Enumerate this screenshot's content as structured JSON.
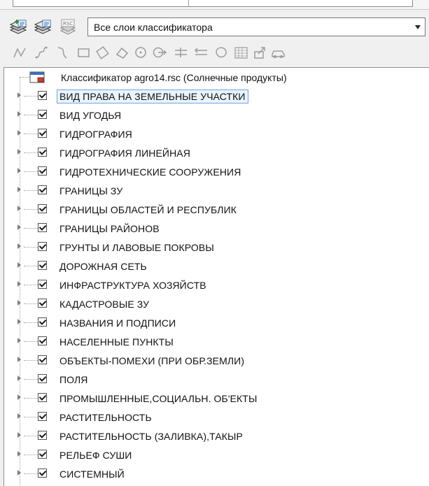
{
  "toolbar_top": {
    "classifier_select_value": "Все слои классификатора",
    "icons": [
      "layer-stack-add-icon",
      "layer-stack-edit-icon",
      "rsc-file-icon"
    ],
    "rsc_label": "RSC"
  },
  "toolbar_drawing": {
    "icons": [
      "polyline-icon",
      "spline-icon",
      "curve-icon",
      "rectangle-icon",
      "rhombus-icon",
      "polygon-icon",
      "circle-icon",
      "circle-arrow-icon",
      "parallel-lines-icon",
      "parallel-lines-arrow-icon",
      "freeform-shape-icon",
      "grid-table-icon",
      "export-object-icon",
      "vehicle-icon"
    ]
  },
  "tree": {
    "root_label": "Классификатор agro14.rsc (Солнечные продукты)",
    "items": [
      {
        "label": "ВИД ПРАВА НА ЗЕМЕЛЬНЫЕ УЧАСТКИ",
        "checked": true,
        "selected": true
      },
      {
        "label": "ВИД УГОДЬЯ",
        "checked": true
      },
      {
        "label": "ГИДРОГРАФИЯ",
        "checked": true
      },
      {
        "label": "ГИДРОГРАФИЯ ЛИНЕЙНАЯ",
        "checked": true
      },
      {
        "label": "ГИДРОТЕХНИЧЕСКИЕ СООРУЖЕНИЯ",
        "checked": true
      },
      {
        "label": "ГРАНИЦЫ ЗУ",
        "checked": true
      },
      {
        "label": "ГРАНИЦЫ ОБЛАСТЕЙ И РЕСПУБЛИК",
        "checked": true
      },
      {
        "label": "ГРАНИЦЫ РАЙОНОВ",
        "checked": true
      },
      {
        "label": "ГРУНТЫ И ЛАВОВЫЕ ПОКРОВЫ",
        "checked": true
      },
      {
        "label": "ДОРОЖНАЯ СЕТЬ",
        "checked": true
      },
      {
        "label": "ИНФРАСТРУКТУРА ХОЗЯЙСТВ",
        "checked": true
      },
      {
        "label": "КАДАСТРОВЫЕ ЗУ",
        "checked": true
      },
      {
        "label": "НАЗВАНИЯ И ПОДПИСИ",
        "checked": true
      },
      {
        "label": "НАСЕЛЕННЫЕ ПУНКТЫ",
        "checked": true
      },
      {
        "label": "ОБЪЕКТЫ-ПОМЕХИ (ПРИ ОБР.ЗЕМЛИ)",
        "checked": true
      },
      {
        "label": "ПОЛЯ",
        "checked": true
      },
      {
        "label": "ПРОМЫШЛЕННЫЕ,СОЦИАЛЬН. ОБ'ЕКТЫ",
        "checked": true
      },
      {
        "label": "РАСТИТЕЛЬНОСТЬ",
        "checked": true
      },
      {
        "label": "РАСТИТЕЛЬНОСТЬ (ЗАЛИВКА),ТАКЫР",
        "checked": true
      },
      {
        "label": "РЕЛЬЕФ СУШИ",
        "checked": true
      },
      {
        "label": "СИСТЕМНЫЙ",
        "checked": true
      }
    ]
  }
}
